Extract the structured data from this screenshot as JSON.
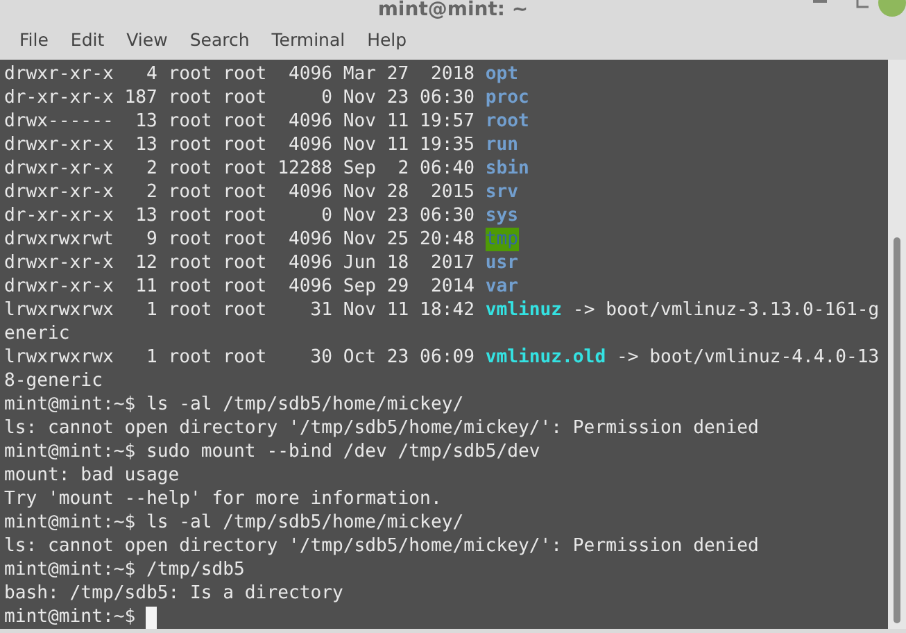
{
  "window": {
    "title": "mint@mint: ~"
  },
  "menu": [
    "File",
    "Edit",
    "View",
    "Search",
    "Terminal",
    "Help"
  ],
  "terminal": {
    "cursor_visible": true,
    "lines": [
      [
        {
          "kind": "plain",
          "text": "drwxr-xr-x   4 root root  4096 Mar 27  2018 "
        },
        {
          "kind": "dir",
          "text": "opt"
        }
      ],
      [
        {
          "kind": "plain",
          "text": "dr-xr-xr-x 187 root root     0 Nov 23 06:30 "
        },
        {
          "kind": "dir",
          "text": "proc"
        }
      ],
      [
        {
          "kind": "plain",
          "text": "drwx------  13 root root  4096 Nov 11 19:57 "
        },
        {
          "kind": "dir",
          "text": "root"
        }
      ],
      [
        {
          "kind": "plain",
          "text": "drwxr-xr-x  13 root root  4096 Nov 11 19:35 "
        },
        {
          "kind": "dir",
          "text": "run"
        }
      ],
      [
        {
          "kind": "plain",
          "text": "drwxr-xr-x   2 root root 12288 Sep  2 06:40 "
        },
        {
          "kind": "dir",
          "text": "sbin"
        }
      ],
      [
        {
          "kind": "plain",
          "text": "drwxr-xr-x   2 root root  4096 Nov 28  2015 "
        },
        {
          "kind": "dir",
          "text": "srv"
        }
      ],
      [
        {
          "kind": "plain",
          "text": "dr-xr-xr-x  13 root root     0 Nov 23 06:30 "
        },
        {
          "kind": "dir",
          "text": "sys"
        }
      ],
      [
        {
          "kind": "plain",
          "text": "drwxrwxrwt   9 root root  4096 Nov 25 20:48 "
        },
        {
          "kind": "sticky",
          "text": "tmp"
        }
      ],
      [
        {
          "kind": "plain",
          "text": "drwxr-xr-x  12 root root  4096 Jun 18  2017 "
        },
        {
          "kind": "dir",
          "text": "usr"
        }
      ],
      [
        {
          "kind": "plain",
          "text": "drwxr-xr-x  11 root root  4096 Sep 29  2014 "
        },
        {
          "kind": "dir",
          "text": "var"
        }
      ],
      [
        {
          "kind": "plain",
          "text": "lrwxrwxrwx   1 root root    31 Nov 11 18:42 "
        },
        {
          "kind": "link",
          "text": "vmlinuz"
        },
        {
          "kind": "plain",
          "text": " -> boot/vmlinuz-3.13.0-161-g"
        }
      ],
      [
        {
          "kind": "plain",
          "text": "eneric"
        }
      ],
      [
        {
          "kind": "plain",
          "text": "lrwxrwxrwx   1 root root    30 Oct 23 06:09 "
        },
        {
          "kind": "link",
          "text": "vmlinuz.old"
        },
        {
          "kind": "plain",
          "text": " -> boot/vmlinuz-4.4.0-13"
        }
      ],
      [
        {
          "kind": "plain",
          "text": "8-generic"
        }
      ],
      [
        {
          "kind": "plain",
          "text": "mint@mint:~$ ls -al /tmp/sdb5/home/mickey/"
        }
      ],
      [
        {
          "kind": "plain",
          "text": "ls: cannot open directory '/tmp/sdb5/home/mickey/': Permission denied"
        }
      ],
      [
        {
          "kind": "plain",
          "text": "mint@mint:~$ sudo mount --bind /dev /tmp/sdb5/dev"
        }
      ],
      [
        {
          "kind": "plain",
          "text": "mount: bad usage"
        }
      ],
      [
        {
          "kind": "plain",
          "text": "Try 'mount --help' for more information."
        }
      ],
      [
        {
          "kind": "plain",
          "text": "mint@mint:~$ ls -al /tmp/sdb5/home/mickey/"
        }
      ],
      [
        {
          "kind": "plain",
          "text": "ls: cannot open directory '/tmp/sdb5/home/mickey/': Permission denied"
        }
      ],
      [
        {
          "kind": "plain",
          "text": "mint@mint:~$ /tmp/sdb5"
        }
      ],
      [
        {
          "kind": "plain",
          "text": "bash: /tmp/sdb5: Is a directory"
        }
      ],
      [
        {
          "kind": "plain",
          "text": "mint@mint:~$ "
        }
      ]
    ]
  }
}
